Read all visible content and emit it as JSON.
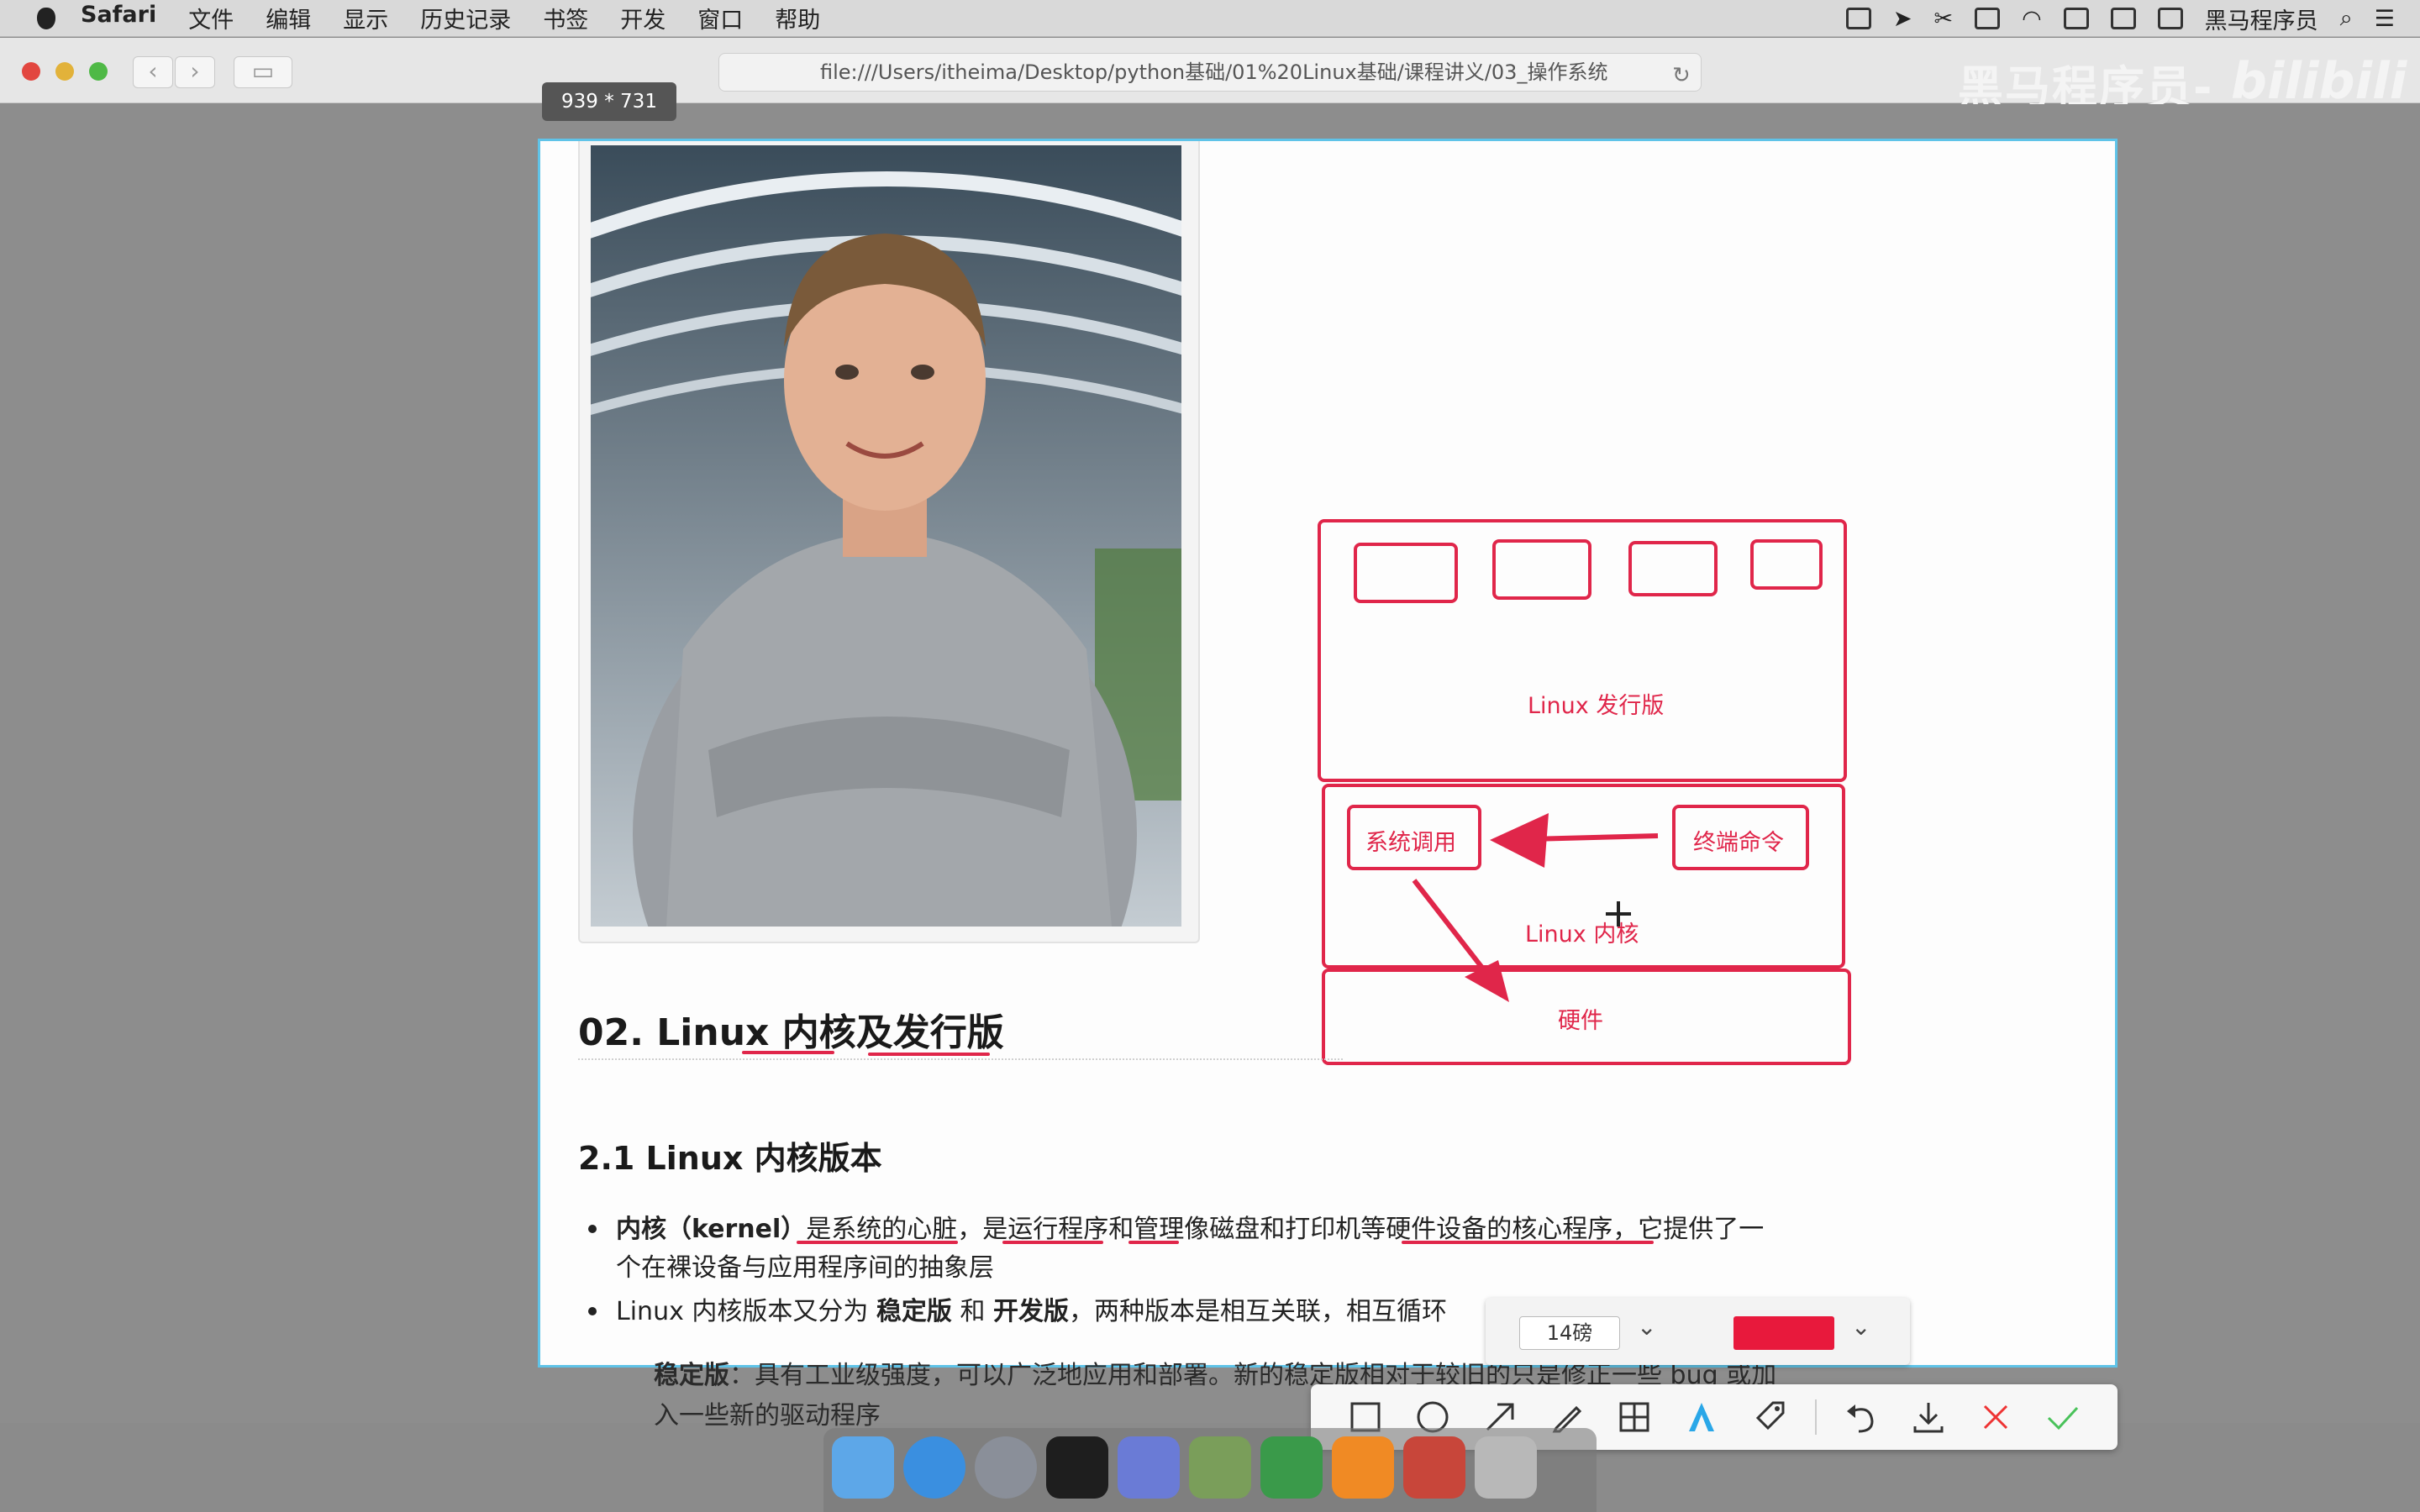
{
  "menubar": {
    "app": "Safari",
    "items": [
      "文件",
      "编辑",
      "显示",
      "历史记录",
      "书签",
      "开发",
      "窗口",
      "帮助"
    ],
    "status_label": "黑马程序员"
  },
  "browser": {
    "url": "file:///Users/itheima/Desktop/python基础/01%20Linux基础/课程讲义/03_操作系统",
    "watermark": "黑马程序员-",
    "watermark_logo": "bilibili"
  },
  "capture": {
    "dimensions": "939 * 731"
  },
  "diagram": {
    "distro_label": "Linux 发行版",
    "syscall_label": "系统调用",
    "terminal_label": "终端命令",
    "kernel_label": "Linux 内核",
    "hardware_label": "硬件"
  },
  "document": {
    "section_title": "02. Linux 内核及发行版",
    "subsection_title": "2.1 Linux 内核版本",
    "bullet1_line1_bold": "内核（kernel）",
    "bullet1_line1_rest": "是系统的心脏，是运行程序和管理像磁盘和打印机等硬件设备的核心程序，它提供了一",
    "bullet1_line2": "个在裸设备与应用程序间的抽象层",
    "bullet2_a": "Linux 内核版本又分为 ",
    "bullet2_b": "稳定版",
    "bullet2_c": " 和 ",
    "bullet2_d": "开发版",
    "bullet2_e": "，两种版本是相互关联，相互循环",
    "sub1_bold": "稳定版",
    "sub1_rest": "：具有工业级强度，可以广泛地应用和部署。新的稳定版相对于较旧的只是修正一些 bug 或加",
    "sub1_line2": "入一些新的驱动程序"
  },
  "annotation": {
    "font_size": "14磅",
    "color": "#e8193c",
    "tools": [
      "rectangle-icon",
      "ellipse-icon",
      "arrow-icon",
      "pen-icon",
      "mosaic-icon",
      "text-icon",
      "tag-icon",
      "undo-icon",
      "download-icon",
      "cancel-icon",
      "confirm-icon"
    ]
  }
}
